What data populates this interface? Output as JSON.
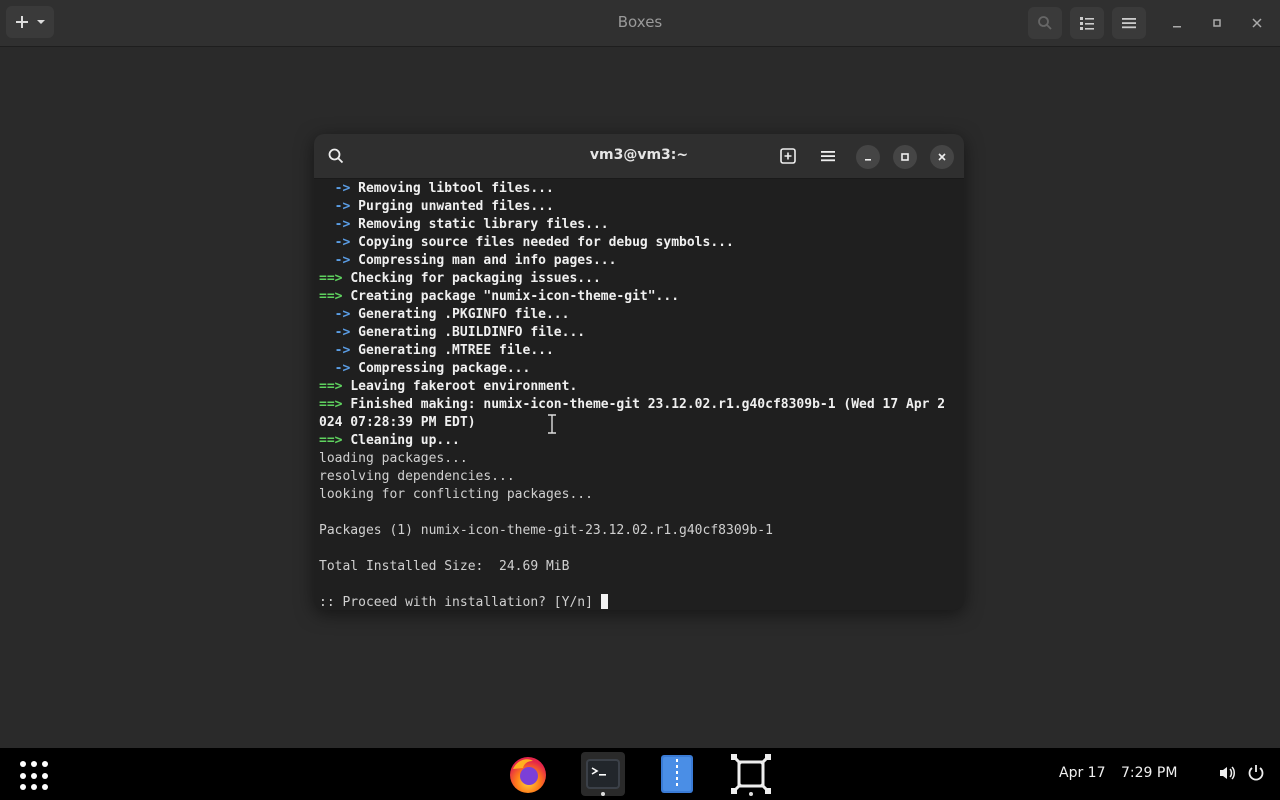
{
  "host": {
    "title": "Boxes"
  },
  "terminal": {
    "title": "vm3@vm3:~",
    "lines": [
      {
        "prefix": "  -> ",
        "kind": "arrow",
        "text": "Removing libtool files..."
      },
      {
        "prefix": "  -> ",
        "kind": "arrow",
        "text": "Purging unwanted files..."
      },
      {
        "prefix": "  -> ",
        "kind": "arrow",
        "text": "Removing static library files..."
      },
      {
        "prefix": "  -> ",
        "kind": "arrow",
        "text": "Copying source files needed for debug symbols..."
      },
      {
        "prefix": "  -> ",
        "kind": "arrow",
        "text": "Compressing man and info pages..."
      },
      {
        "prefix": "==> ",
        "kind": "green",
        "text": "Checking for packaging issues..."
      },
      {
        "prefix": "==> ",
        "kind": "green",
        "text": "Creating package \"numix-icon-theme-git\"..."
      },
      {
        "prefix": "  -> ",
        "kind": "arrow",
        "text": "Generating .PKGINFO file..."
      },
      {
        "prefix": "  -> ",
        "kind": "arrow",
        "text": "Generating .BUILDINFO file..."
      },
      {
        "prefix": "  -> ",
        "kind": "arrow",
        "text": "Generating .MTREE file..."
      },
      {
        "prefix": "  -> ",
        "kind": "arrow",
        "text": "Compressing package..."
      },
      {
        "prefix": "==> ",
        "kind": "green",
        "text": "Leaving fakeroot environment."
      },
      {
        "prefix": "==> ",
        "kind": "green",
        "text": "Finished making: numix-icon-theme-git 23.12.02.r1.g40cf8309b-1 (Wed 17 Apr 2"
      },
      {
        "prefix": "",
        "kind": "bold",
        "text": "024 07:28:39 PM EDT)"
      },
      {
        "prefix": "==> ",
        "kind": "green",
        "text": "Cleaning up..."
      },
      {
        "prefix": "",
        "kind": "plain",
        "text": "loading packages..."
      },
      {
        "prefix": "",
        "kind": "plain",
        "text": "resolving dependencies..."
      },
      {
        "prefix": "",
        "kind": "plain",
        "text": "looking for conflicting packages..."
      },
      {
        "prefix": "",
        "kind": "plain",
        "text": ""
      },
      {
        "prefix": "",
        "kind": "plain",
        "text": "Packages (1) numix-icon-theme-git-23.12.02.r1.g40cf8309b-1"
      },
      {
        "prefix": "",
        "kind": "plain",
        "text": ""
      },
      {
        "prefix": "",
        "kind": "plain",
        "text": "Total Installed Size:  24.69 MiB"
      },
      {
        "prefix": "",
        "kind": "plain",
        "text": ""
      },
      {
        "prefix": "",
        "kind": "prompt",
        "text": ":: Proceed with installation? [Y/n] "
      }
    ]
  },
  "taskbar": {
    "date": "Apr 17",
    "time": "7:29 PM"
  }
}
